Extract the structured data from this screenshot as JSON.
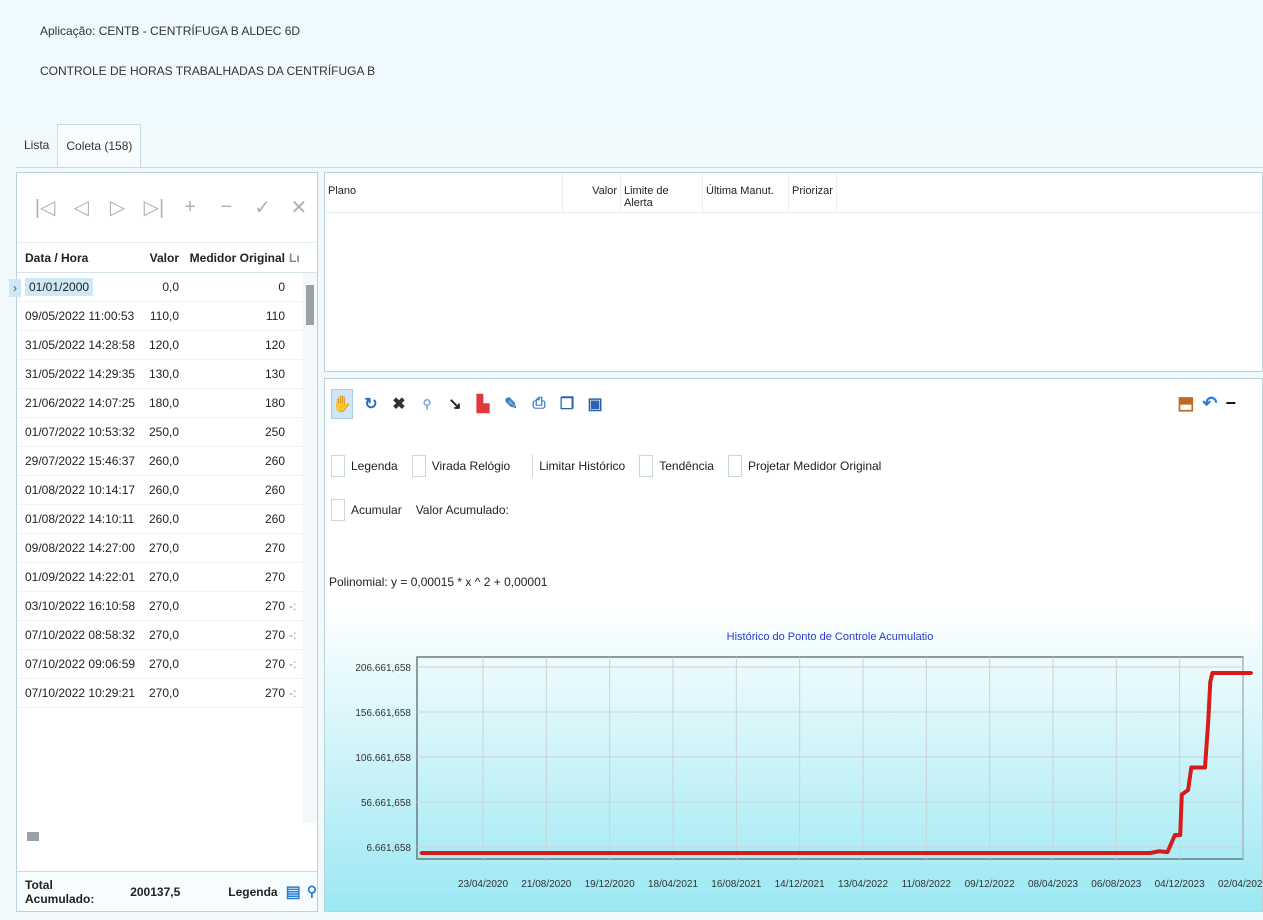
{
  "header": {
    "app_line": "Aplicação:  CENTB - CENTRÍFUGA B ALDEC 6D",
    "subtitle": "CONTROLE DE HORAS TRABALHADAS DA CENTRÍFUGA B"
  },
  "tabs": [
    {
      "label": "Lista"
    },
    {
      "label": "Coleta (158)"
    }
  ],
  "nav": [
    "first",
    "prev",
    "next",
    "last",
    "add",
    "remove",
    "confirm",
    "cancel"
  ],
  "grid": {
    "headers": [
      "Data / Hora",
      "Valor",
      "Medidor Original",
      "Lı"
    ],
    "rows": [
      {
        "dt": "01/01/2000",
        "val": "0,0",
        "med": "0",
        "ex": ""
      },
      {
        "dt": "09/05/2022 11:00:53",
        "val": "110,0",
        "med": "110",
        "ex": ""
      },
      {
        "dt": "31/05/2022 14:28:58",
        "val": "120,0",
        "med": "120",
        "ex": ""
      },
      {
        "dt": "31/05/2022 14:29:35",
        "val": "130,0",
        "med": "130",
        "ex": ""
      },
      {
        "dt": "21/06/2022 14:07:25",
        "val": "180,0",
        "med": "180",
        "ex": ""
      },
      {
        "dt": "01/07/2022 10:53:32",
        "val": "250,0",
        "med": "250",
        "ex": ""
      },
      {
        "dt": "29/07/2022 15:46:37",
        "val": "260,0",
        "med": "260",
        "ex": ""
      },
      {
        "dt": "01/08/2022 10:14:17",
        "val": "260,0",
        "med": "260",
        "ex": ""
      },
      {
        "dt": "01/08/2022 14:10:11",
        "val": "260,0",
        "med": "260",
        "ex": ""
      },
      {
        "dt": "09/08/2022 14:27:00",
        "val": "270,0",
        "med": "270",
        "ex": ""
      },
      {
        "dt": "01/09/2022 14:22:01",
        "val": "270,0",
        "med": "270",
        "ex": ""
      },
      {
        "dt": "03/10/2022 16:10:58",
        "val": "270,0",
        "med": "270",
        "ex": "-:"
      },
      {
        "dt": "07/10/2022 08:58:32",
        "val": "270,0",
        "med": "270",
        "ex": "-:"
      },
      {
        "dt": "07/10/2022 09:06:59",
        "val": "270,0",
        "med": "270",
        "ex": "-:"
      },
      {
        "dt": "07/10/2022 10:29:21",
        "val": "270,0",
        "med": "270",
        "ex": "-:"
      }
    ]
  },
  "footer": {
    "total_label": "Total Acumulado:",
    "total_value": "200137,5",
    "legend_label": "Legenda"
  },
  "plan": {
    "headers": [
      "Plano",
      "Valor",
      "Limite de Alerta",
      "Última Manut.",
      "Priorizar"
    ]
  },
  "toolbar": {
    "icons": [
      "pan-hand-icon",
      "refresh-icon",
      "close-x-icon",
      "zoom-icon",
      "line-tool-icon",
      "bar-chart-icon",
      "edit-icon",
      "print-icon",
      "copy-icon",
      "save-icon"
    ],
    "right_icons": [
      "export-icon",
      "undo-icon",
      "minimize-icon"
    ]
  },
  "options": {
    "legenda": "Legenda",
    "virada": "Virada Relógio",
    "limitar": "Limitar Histórico",
    "tendencia": "Tendência",
    "projetar": "Projetar Medidor Original",
    "acumular": "Acumular",
    "valor_acumulado": "Valor Acumulado:",
    "polinomial": "Polinomial: y = 0,00015 * x ^ 2 + 0,00001"
  },
  "colors": {
    "line": "#d61b1b",
    "title": "#2a3ad6"
  },
  "chart_data": {
    "type": "line",
    "title": "Histórico do Ponto de Controle Acumulatio",
    "y_ticks": [
      "206.661,658",
      "156.661,658",
      "106.661,658",
      "56.661,658",
      "6.661,658"
    ],
    "x_ticks": [
      "23/04/2020",
      "21/08/2020",
      "19/12/2020",
      "18/04/2021",
      "16/08/2021",
      "14/12/2021",
      "13/04/2022",
      "11/08/2022",
      "09/12/2022",
      "08/04/2023",
      "06/08/2023",
      "04/12/2023",
      "02/04/2024"
    ],
    "ylim": [
      0,
      220000
    ],
    "grid": true,
    "series": [
      {
        "points": [
          {
            "x": "01/01/2000",
            "y": 0
          },
          {
            "x": "10/10/2023",
            "y": 0
          },
          {
            "x": "26/10/2023",
            "y": 2000
          },
          {
            "x": "11/11/2023",
            "y": 1000
          },
          {
            "x": "25/11/2023",
            "y": 20000
          },
          {
            "x": "05/12/2023",
            "y": 20000
          },
          {
            "x": "08/12/2023",
            "y": 65000
          },
          {
            "x": "20/12/2023",
            "y": 70000
          },
          {
            "x": "26/12/2023",
            "y": 95000
          },
          {
            "x": "21/01/2024",
            "y": 95000
          },
          {
            "x": "27/01/2024",
            "y": 145000
          },
          {
            "x": "31/01/2024",
            "y": 190000
          },
          {
            "x": "04/02/2024",
            "y": 200000
          },
          {
            "x": "18/04/2024",
            "y": 200000
          }
        ]
      }
    ]
  }
}
